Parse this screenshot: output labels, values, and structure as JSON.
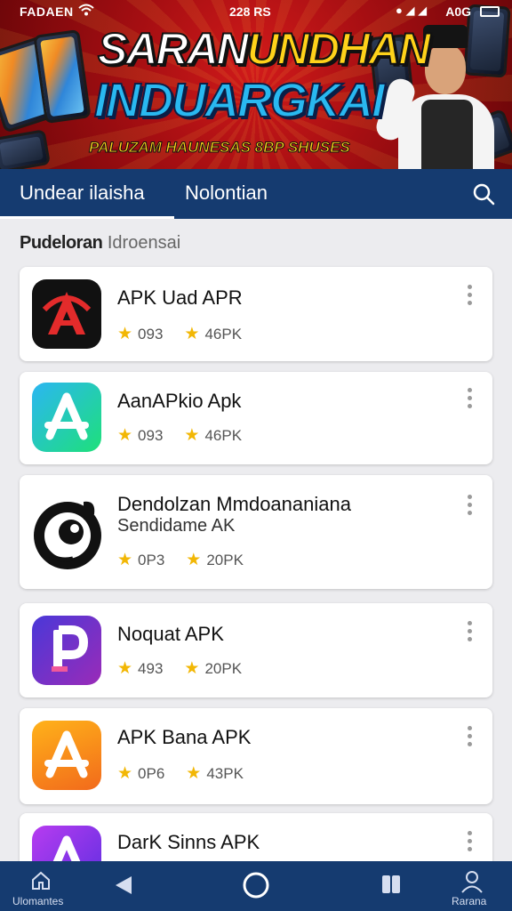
{
  "status_bar": {
    "carrier": "FADAEN",
    "time": "228 RS",
    "network": "A0G"
  },
  "banner": {
    "headline_white": "SARAN",
    "headline_yellow": "UNDHAN",
    "headline_2": "INDUARGKAI",
    "subline": "PALUZAM HAUNESAS 8BP SHUSES"
  },
  "tabs": [
    {
      "label": "Undear ilaisha",
      "active": true
    },
    {
      "label": "Nolontian",
      "active": false
    }
  ],
  "section": {
    "bold": "Pudeloran",
    "light": "Idroensai"
  },
  "apps": [
    {
      "title": "APK Uad APR",
      "subtitle": "",
      "rating": "093",
      "downloads": "46PK",
      "icon": "red-a-icon"
    },
    {
      "title": "AanAPkio Apk",
      "subtitle": "",
      "rating": "093",
      "downloads": "46PK",
      "icon": "store-a-icon"
    },
    {
      "title": "Dendolzan Mmdoananiana",
      "subtitle": "Sendidame AK",
      "rating": "0P3",
      "downloads": "20PK",
      "icon": "bird-icon"
    },
    {
      "title": "Noquat APK",
      "subtitle": "",
      "rating": "493",
      "downloads": "20PK",
      "icon": "p-logo-icon"
    },
    {
      "title": "APK Bana APK",
      "subtitle": "",
      "rating": "0P6",
      "downloads": "43PK",
      "icon": "orange-a-icon"
    },
    {
      "title": "DarK Sinns APK",
      "subtitle": "",
      "rating": "",
      "downloads": "",
      "icon": "purple-a-icon"
    }
  ],
  "bottom_nav": {
    "home_label": "Ulomantes",
    "profile_label": "Rarana"
  },
  "colors": {
    "nav_bg": "#153b70",
    "banner_red": "#b3121a",
    "star": "#f2b705"
  }
}
